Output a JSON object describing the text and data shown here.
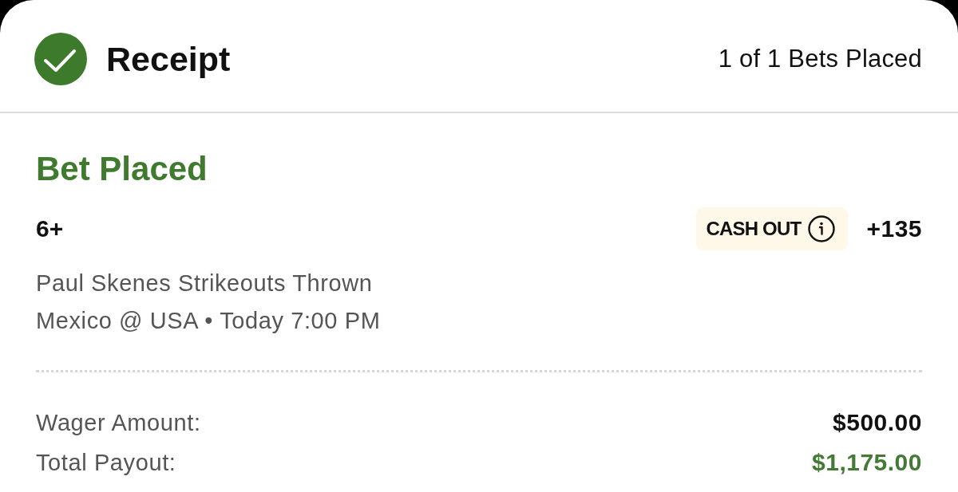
{
  "header": {
    "title": "Receipt",
    "count": "1 of 1 Bets Placed"
  },
  "bet": {
    "status": "Bet Placed",
    "selection": "6+",
    "cash_out": {
      "label": "CASH OUT"
    },
    "odds": "+135",
    "market": "Paul Skenes Strikeouts Thrown",
    "event": "Mexico @ USA • Today 7:00 PM"
  },
  "summary": [
    {
      "kind": "amount",
      "label": "Wager Amount:",
      "value": "$500.00"
    },
    {
      "kind": "payout",
      "label": "Total Payout:",
      "value": "$1,175.00"
    }
  ]
}
